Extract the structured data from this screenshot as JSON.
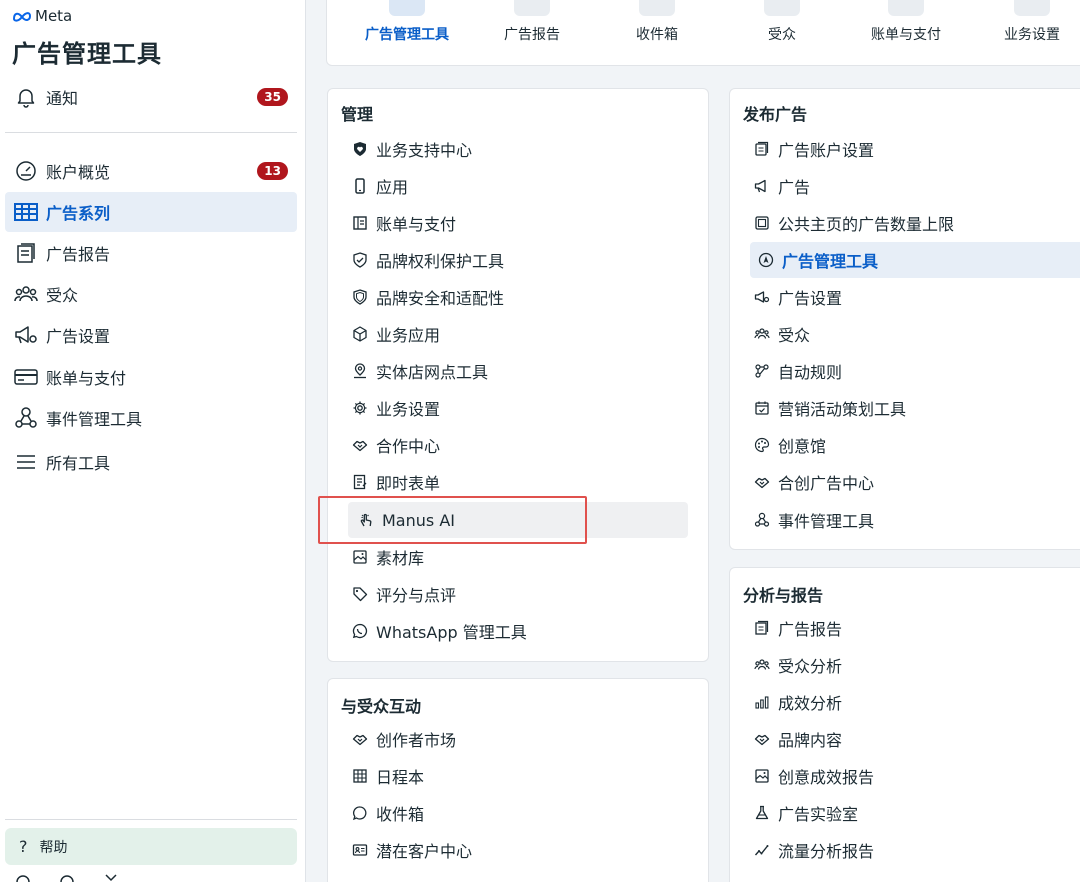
{
  "brand": {
    "logo_text": "Meta",
    "app_title": "广告管理工具"
  },
  "sidebar": {
    "notifications": {
      "label": "通知",
      "badge": "35"
    },
    "items": [
      {
        "label": "账户概览",
        "icon": "gauge-icon",
        "badge": "13"
      },
      {
        "label": "广告系列",
        "icon": "table-icon",
        "active": true
      },
      {
        "label": "广告报告",
        "icon": "report-icon"
      },
      {
        "label": "受众",
        "icon": "people-icon"
      },
      {
        "label": "广告设置",
        "icon": "megaphone-gear-icon"
      },
      {
        "label": "账单与支付",
        "icon": "credit-card-icon"
      },
      {
        "label": "事件管理工具",
        "icon": "nodes-icon"
      },
      {
        "label": "所有工具",
        "icon": "menu-icon"
      }
    ],
    "help_label": "帮助"
  },
  "topnav": {
    "items": [
      {
        "label": "广告管理工具",
        "active": true
      },
      {
        "label": "广告报告"
      },
      {
        "label": "收件箱"
      },
      {
        "label": "受众"
      },
      {
        "label": "账单与支付"
      },
      {
        "label": "业务设置"
      }
    ]
  },
  "manage": {
    "title": "管理",
    "items": [
      {
        "label": "业务支持中心",
        "icon": "shield-heart-icon"
      },
      {
        "label": "应用",
        "icon": "phone-icon"
      },
      {
        "label": "账单与支付",
        "icon": "ledger-icon"
      },
      {
        "label": "品牌权利保护工具",
        "icon": "shield-check-icon"
      },
      {
        "label": "品牌安全和适配性",
        "icon": "shield-icon"
      },
      {
        "label": "业务应用",
        "icon": "cube-icon"
      },
      {
        "label": "实体店网点工具",
        "icon": "location-pin-icon"
      },
      {
        "label": "业务设置",
        "icon": "gear-icon"
      },
      {
        "label": "合作中心",
        "icon": "handshake-icon"
      },
      {
        "label": "即时表单",
        "icon": "form-icon"
      },
      {
        "label": "Manus AI",
        "icon": "hand-tap-icon",
        "highlighted": true
      },
      {
        "label": "素材库",
        "icon": "image-icon"
      },
      {
        "label": "评分与点评",
        "icon": "tag-icon"
      },
      {
        "label": "WhatsApp 管理工具",
        "icon": "whatsapp-icon"
      }
    ]
  },
  "engage": {
    "title": "与受众互动",
    "items": [
      {
        "label": "创作者市场",
        "icon": "handshake-icon"
      },
      {
        "label": "日程本",
        "icon": "calendar-grid-icon"
      },
      {
        "label": "收件箱",
        "icon": "chat-bubble-icon"
      },
      {
        "label": "潜在客户中心",
        "icon": "contact-card-icon"
      }
    ]
  },
  "publish": {
    "title": "发布广告",
    "items": [
      {
        "label": "广告账户设置",
        "icon": "account-settings-icon"
      },
      {
        "label": "广告",
        "icon": "megaphone-icon"
      },
      {
        "label": "公共主页的广告数量上限",
        "icon": "page-limit-icon"
      },
      {
        "label": "广告管理工具",
        "icon": "navigation-icon",
        "selected": true
      },
      {
        "label": "广告设置",
        "icon": "megaphone-gear-icon"
      },
      {
        "label": "受众",
        "icon": "people-icon"
      },
      {
        "label": "自动规则",
        "icon": "flow-icon"
      },
      {
        "label": "营销活动策划工具",
        "icon": "calendar-check-icon"
      },
      {
        "label": "创意馆",
        "icon": "palette-icon"
      },
      {
        "label": "合创广告中心",
        "icon": "handshake-icon"
      },
      {
        "label": "事件管理工具",
        "icon": "nodes-icon"
      }
    ]
  },
  "analytics": {
    "title": "分析与报告",
    "items": [
      {
        "label": "广告报告",
        "icon": "report-icon"
      },
      {
        "label": "受众分析",
        "icon": "people-icon"
      },
      {
        "label": "成效分析",
        "icon": "bar-chart-icon"
      },
      {
        "label": "品牌内容",
        "icon": "handshake-icon"
      },
      {
        "label": "创意成效报告",
        "icon": "image-icon"
      },
      {
        "label": "广告实验室",
        "icon": "flask-icon"
      },
      {
        "label": "流量分析报告",
        "icon": "trend-icon"
      }
    ]
  },
  "colors": {
    "accent": "#0a5ec8",
    "badge_red": "#b0161d",
    "highlight_box": "#e0514d"
  }
}
